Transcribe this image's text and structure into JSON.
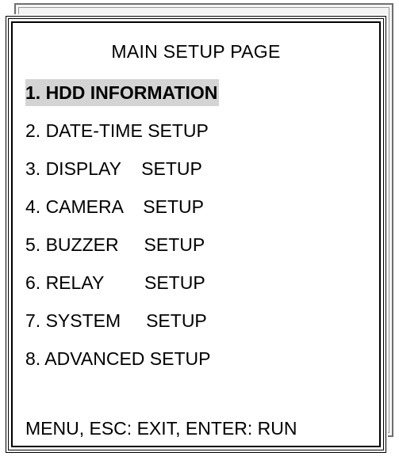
{
  "screen": {
    "title": "MAIN SETUP PAGE",
    "items": [
      {
        "label": "1. HDD INFORMATION",
        "selected": true
      },
      {
        "label": "2. DATE-TIME SETUP",
        "selected": false
      },
      {
        "label": "3. DISPLAY    SETUP",
        "selected": false
      },
      {
        "label": "4. CAMERA    SETUP",
        "selected": false
      },
      {
        "label": "5. BUZZER     SETUP",
        "selected": false
      },
      {
        "label": "6. RELAY        SETUP",
        "selected": false
      },
      {
        "label": "7. SYSTEM     SETUP",
        "selected": false
      },
      {
        "label": "8. ADVANCED SETUP",
        "selected": false
      }
    ],
    "footer": "MENU, ESC: EXIT, ENTER: RUN"
  },
  "colors": {
    "background": "#ffffff",
    "text": "#000000",
    "highlight": "#d4d4d4",
    "border": "#000000",
    "shadow_border": "#6f6f6f"
  }
}
